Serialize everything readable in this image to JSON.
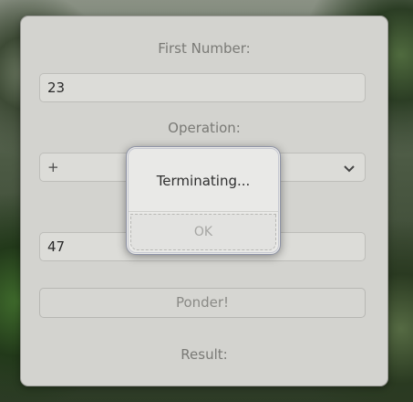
{
  "form": {
    "first_number_label": "First Number:",
    "first_number_value": "23",
    "operation_label": "Operation:",
    "operation_value": "+",
    "second_number_value": "47",
    "ponder_button": "Ponder!",
    "result_label": "Result:"
  },
  "dialog": {
    "message": "Terminating...",
    "ok_label": "OK"
  },
  "icons": {
    "dropdown": "chevron-down-icon"
  }
}
